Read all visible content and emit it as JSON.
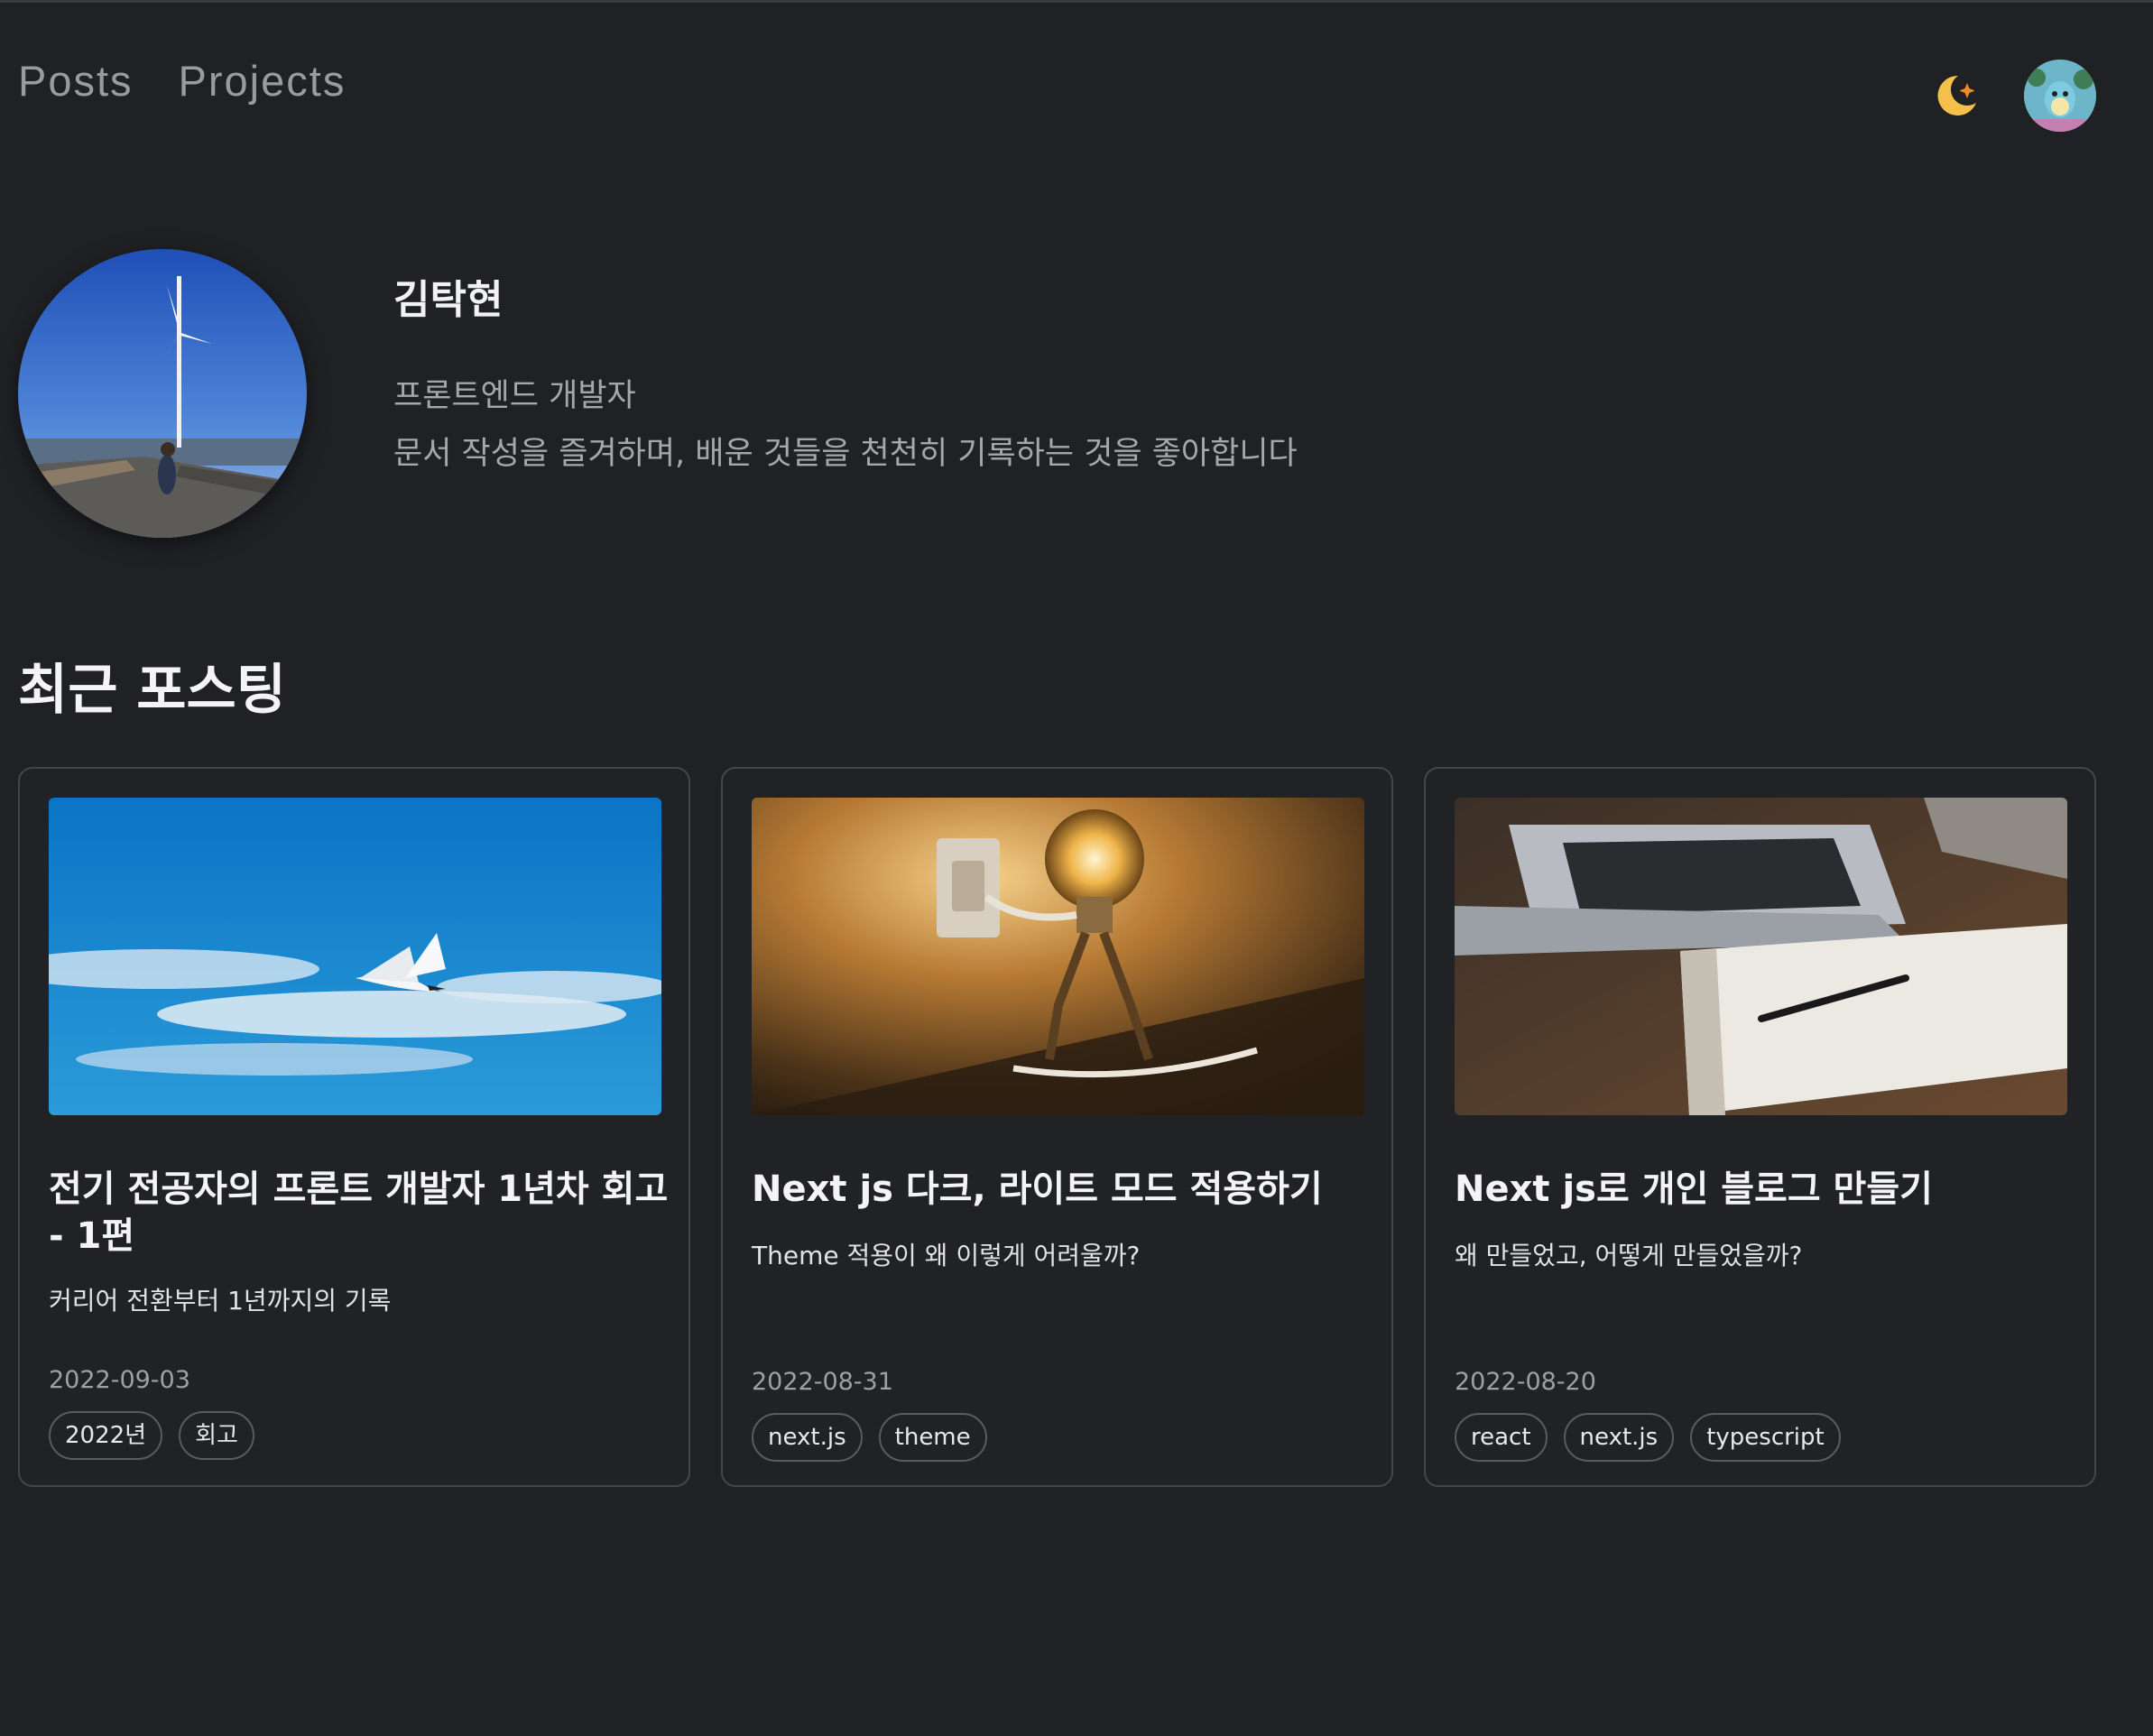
{
  "nav": {
    "links": [
      "Posts",
      "Projects"
    ]
  },
  "header": {
    "theme_icon": "moon-icon",
    "avatar": "avatar"
  },
  "profile": {
    "name": "김탁현",
    "role": "프론트엔드 개발자",
    "description": "문서 작성을 즐겨하며, 배운 것들을 천천히 기록하는 것을 좋아합니다"
  },
  "recent": {
    "title": "최근 포스팅"
  },
  "posts": [
    {
      "title": "전기 전공자의 프론트 개발자 1년차 회고 - 1편",
      "description": "커리어 전환부터 1년까지의 기록",
      "date": "2022-09-03",
      "tags": [
        "2022년",
        "회고"
      ]
    },
    {
      "title": "Next js 다크, 라이트 모드 적용하기",
      "description": "Theme 적용이 왜 이렇게 어려울까?",
      "date": "2022-08-31",
      "tags": [
        "next.js",
        "theme"
      ]
    },
    {
      "title": "Next js로 개인 블로그 만들기",
      "description": "왜 만들었고, 어떻게 만들었을까?",
      "date": "2022-08-20",
      "tags": [
        "react",
        "next.js",
        "typescript"
      ]
    }
  ],
  "colors": {
    "background": "#202125",
    "accent_moon": "#f5c04a"
  }
}
